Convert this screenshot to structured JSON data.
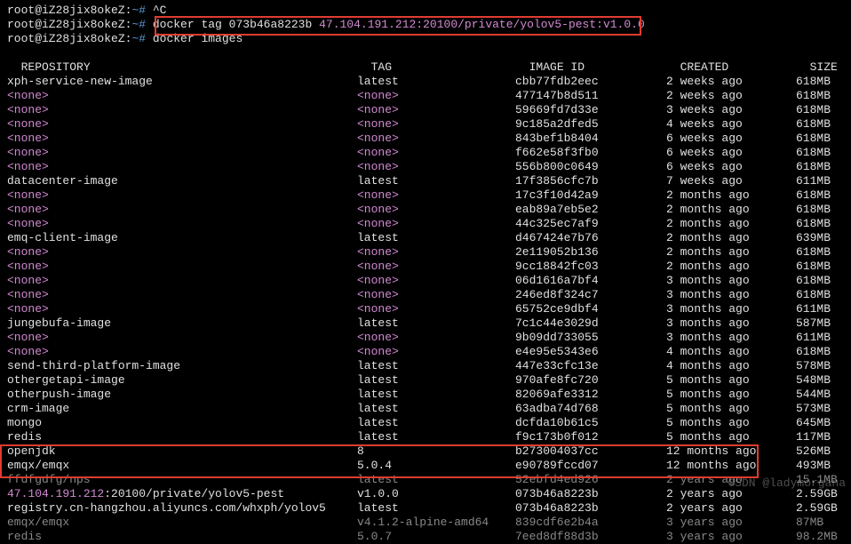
{
  "prompts": {
    "user": "root@iZ28jix8okeZ",
    "sep": ":",
    "tilde": "~#",
    "cmd1": " ^C",
    "cmd2_a": " docker tag 073b46a8223b ",
    "cmd2_b": "47.104.191.212:20100/private/yolov5-pest:v1.0.0",
    "cmd3": " docker images"
  },
  "header": {
    "repo": "REPOSITORY",
    "tag": "TAG",
    "id": "IMAGE ID",
    "created": "CREATED",
    "size": "SIZE"
  },
  "none": "<none>",
  "rows": [
    {
      "repo": "xph-service-new-image",
      "tag": "latest",
      "id": "cbb77fdb2eec",
      "created": "2 weeks ago",
      "size": "618MB"
    },
    {
      "repo": null,
      "tag": null,
      "id": "477147b8d511",
      "created": "2 weeks ago",
      "size": "618MB"
    },
    {
      "repo": null,
      "tag": null,
      "id": "59669fd7d33e",
      "created": "3 weeks ago",
      "size": "618MB"
    },
    {
      "repo": null,
      "tag": null,
      "id": "9c185a2dfed5",
      "created": "4 weeks ago",
      "size": "618MB"
    },
    {
      "repo": null,
      "tag": null,
      "id": "843bef1b8404",
      "created": "6 weeks ago",
      "size": "618MB"
    },
    {
      "repo": null,
      "tag": null,
      "id": "f662e58f3fb0",
      "created": "6 weeks ago",
      "size": "618MB"
    },
    {
      "repo": null,
      "tag": null,
      "id": "556b800c0649",
      "created": "6 weeks ago",
      "size": "618MB"
    },
    {
      "repo": "datacenter-image",
      "tag": "latest",
      "id": "17f3856cfc7b",
      "created": "7 weeks ago",
      "size": "611MB"
    },
    {
      "repo": null,
      "tag": null,
      "id": "17c3f10d42a9",
      "created": "2 months ago",
      "size": "618MB"
    },
    {
      "repo": null,
      "tag": null,
      "id": "eab89a7eb5e2",
      "created": "2 months ago",
      "size": "618MB"
    },
    {
      "repo": null,
      "tag": null,
      "id": "44c325ec7af9",
      "created": "2 months ago",
      "size": "618MB"
    },
    {
      "repo": "emq-client-image",
      "tag": "latest",
      "id": "d467424e7b76",
      "created": "2 months ago",
      "size": "639MB"
    },
    {
      "repo": null,
      "tag": null,
      "id": "2e119052b136",
      "created": "2 months ago",
      "size": "618MB"
    },
    {
      "repo": null,
      "tag": null,
      "id": "9cc18842fc03",
      "created": "2 months ago",
      "size": "618MB"
    },
    {
      "repo": null,
      "tag": null,
      "id": "06d1616a7bf4",
      "created": "3 months ago",
      "size": "618MB"
    },
    {
      "repo": null,
      "tag": null,
      "id": "246ed8f324c7",
      "created": "3 months ago",
      "size": "618MB"
    },
    {
      "repo": null,
      "tag": null,
      "id": "65752ce9dbf4",
      "created": "3 months ago",
      "size": "611MB"
    },
    {
      "repo": "jungebufa-image",
      "tag": "latest",
      "id": "7c1c44e3029d",
      "created": "3 months ago",
      "size": "587MB"
    },
    {
      "repo": null,
      "tag": null,
      "id": "9b09dd733055",
      "created": "3 months ago",
      "size": "611MB"
    },
    {
      "repo": null,
      "tag": null,
      "id": "e4e95e5343e6",
      "created": "4 months ago",
      "size": "618MB"
    },
    {
      "repo": "send-third-platform-image",
      "tag": "latest",
      "id": "447e33cfc13e",
      "created": "4 months ago",
      "size": "578MB"
    },
    {
      "repo": "othergetapi-image",
      "tag": "latest",
      "id": "970afe8fc720",
      "created": "5 months ago",
      "size": "548MB"
    },
    {
      "repo": "otherpush-image",
      "tag": "latest",
      "id": "82069afe3312",
      "created": "5 months ago",
      "size": "544MB"
    },
    {
      "repo": "crm-image",
      "tag": "latest",
      "id": "63adba74d768",
      "created": "5 months ago",
      "size": "573MB"
    },
    {
      "repo": "mongo",
      "tag": "latest",
      "id": "dcfda10b61c5",
      "created": "5 months ago",
      "size": "645MB"
    },
    {
      "repo": "redis",
      "tag": "latest",
      "id": "f9c173b0f012",
      "created": "5 months ago",
      "size": "117MB"
    },
    {
      "repo": "openjdk",
      "tag": "8",
      "id": "b273004037cc",
      "created": "12 months ago",
      "size": "526MB"
    },
    {
      "repo": "emqx/emqx",
      "tag": "5.0.4",
      "id": "e90789fccd07",
      "created": "12 months ago",
      "size": "493MB"
    },
    {
      "repo": "ffdfgdfg/nps",
      "tag": "latest",
      "gray": true,
      "id": "52ebfd4ed926",
      "created": "2 years ago",
      "size": "15.1MB"
    },
    {
      "repo_ip": "47.104.191.212",
      "repo_rest": ":20100/private/yolov5-pest",
      "tag": "v1.0.0",
      "id": "073b46a8223b",
      "created": "2 years ago",
      "size": "2.59GB"
    },
    {
      "repo": "registry.cn-hangzhou.aliyuncs.com/whxph/yolov5",
      "tag": "latest",
      "id": "073b46a8223b",
      "created": "2 years ago",
      "size": "2.59GB"
    },
    {
      "repo": "emqx/emqx",
      "tag": "v4.1.2-alpine-amd64",
      "id": "839cdf6e2b4a",
      "created": "3 years ago",
      "size": "87MB",
      "gray": true
    },
    {
      "repo": "redis",
      "tag": "5.0.7",
      "id": "7eed8df88d3b",
      "created": "3 years ago",
      "size": "98.2MB",
      "gray": true
    }
  ],
  "watermark": "CSDN @ladymorgana"
}
